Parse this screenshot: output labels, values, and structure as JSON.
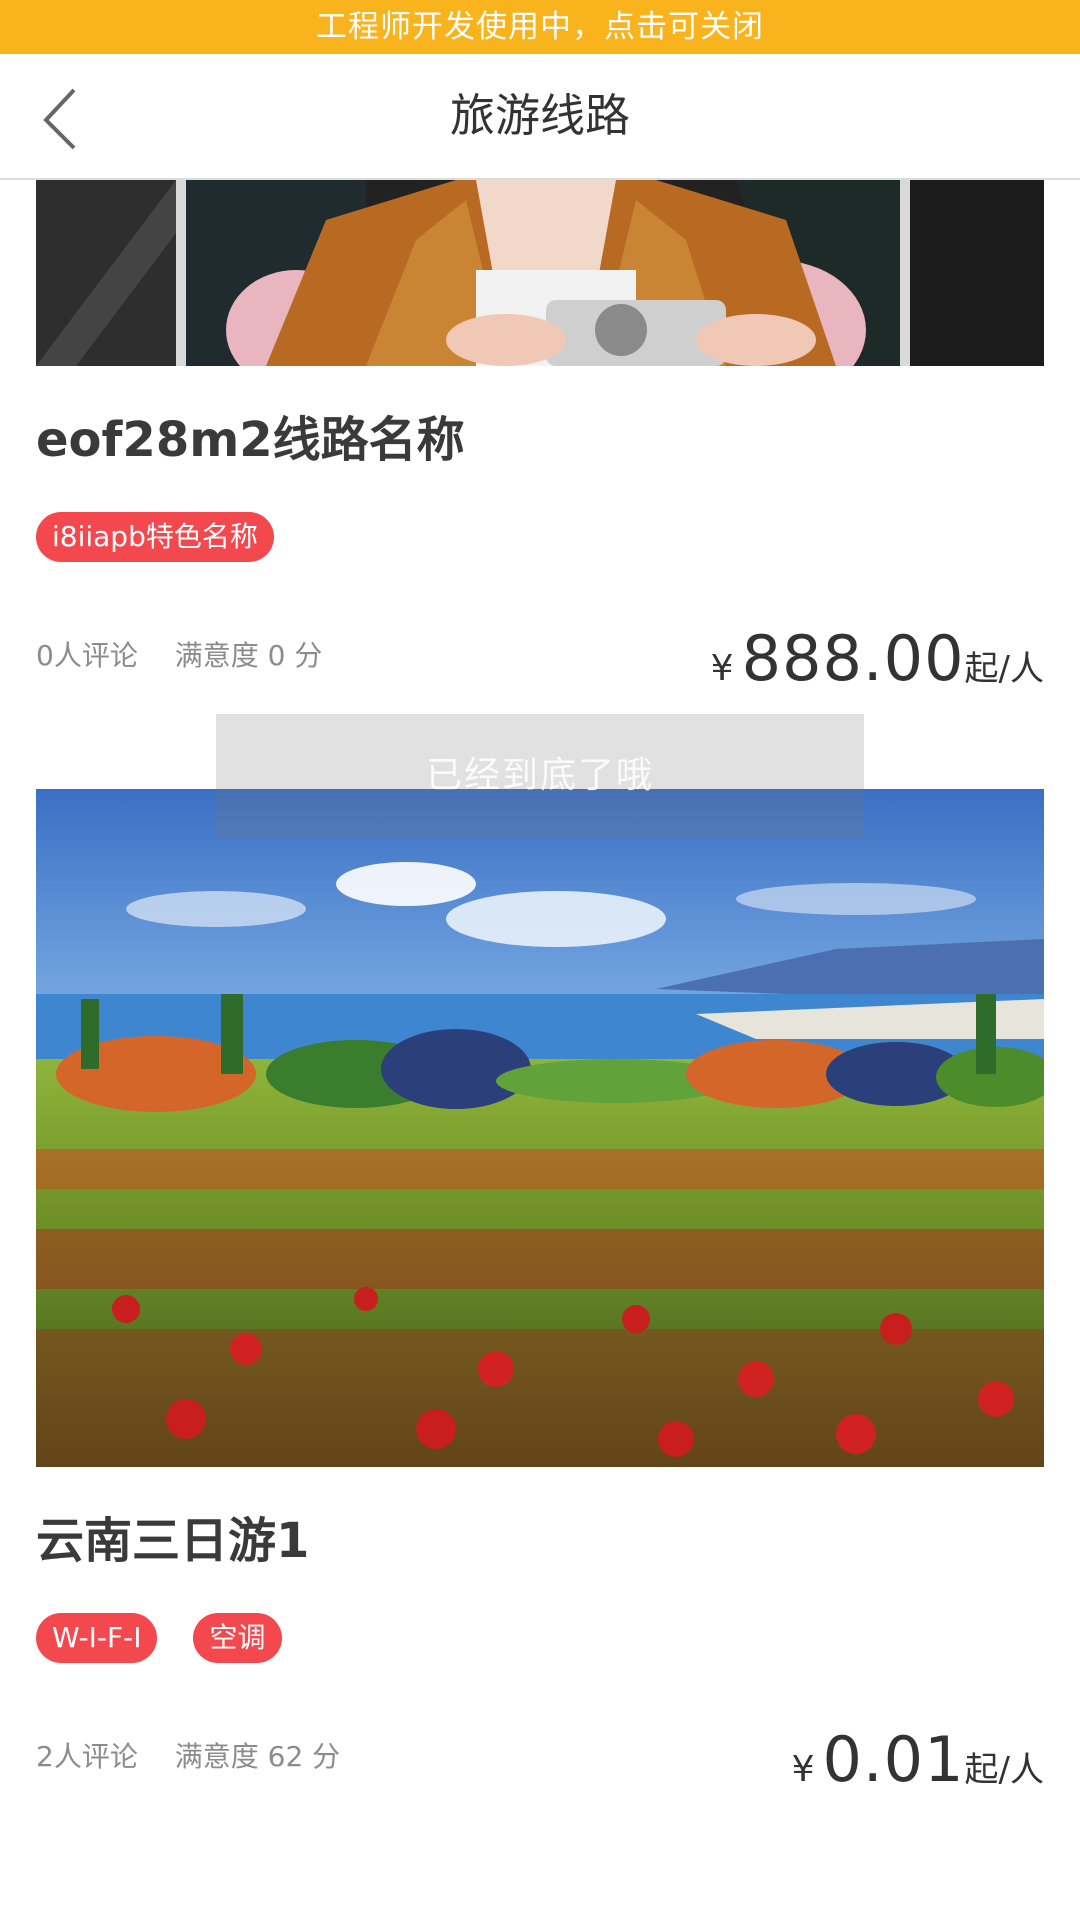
{
  "dev_banner": {
    "text": "工程师开发使用中，点击可关闭"
  },
  "navbar": {
    "title": "旅游线路",
    "back_icon": "chevron-left-icon"
  },
  "routes": [
    {
      "title": "eof28m2线路名称",
      "tags": [
        "i8iiapb特色名称"
      ],
      "reviews": "0人评论",
      "satisfaction": "满意度 0 分",
      "price": {
        "currency": "¥",
        "amount": "888.00",
        "unit": "起/人"
      }
    },
    {
      "title": "云南三日游1",
      "tags": [
        "W-I-F-I",
        "空调"
      ],
      "reviews": "2人评论",
      "satisfaction": "满意度 62 分",
      "price": {
        "currency": "¥",
        "amount": "0.01",
        "unit": "起/人"
      }
    }
  ],
  "toast": {
    "text": "已经到底了哦"
  },
  "colors": {
    "banner": "#f9b31c",
    "tag": "#f4484f"
  }
}
